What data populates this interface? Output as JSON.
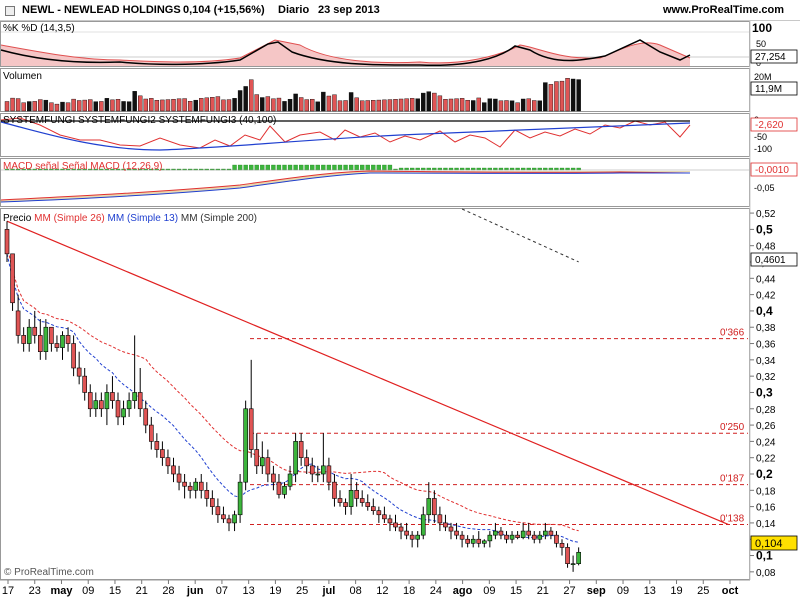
{
  "header": {
    "ticker": "NEWL - NEWLEAD HOLDINGS",
    "quote": "0,104 (+15,56%)",
    "period": "Diario",
    "date": "23 sep 2013",
    "site": "www.ProRealTime.com"
  },
  "footer": {
    "copyright": "© ProRealTime.com"
  },
  "panels": {
    "stoch": {
      "label": "%K %D (14,3,5)",
      "ticks": [
        "100",
        "50",
        "0"
      ],
      "value": "27,254"
    },
    "volume": {
      "label": "Volumen",
      "ticks": [
        "20M"
      ],
      "value": "11,9M"
    },
    "systemfungi": {
      "label": "SYSTEMFUNGI SYSTEMFUNGI2 SYSTEMFUNGI3 (40,100)",
      "ticks": [
        "0",
        "-50",
        "-100"
      ],
      "value": "-2,620"
    },
    "macd": {
      "label": "MACD señal Señal MACD (12,26,9)",
      "ticks": [
        "-0,05"
      ],
      "value": "-0,0010"
    },
    "price": {
      "label_prefix": "Precio",
      "ma26": "MM (Simple 26)",
      "ma13": "MM (Simple 13)",
      "ma200": "MM (Simple 200)",
      "value": "0,104",
      "ma_value": "0,4601"
    }
  },
  "colors": {
    "up": "#3cb53c",
    "down": "#e05555",
    "ma26": "#e03030",
    "ma13": "#2040d0",
    "ma200": "#333333",
    "trendline": "#e02020",
    "level": "#d02020"
  },
  "chart_data": {
    "type": "candlestick",
    "period": "daily",
    "x_axis_labels": [
      "17",
      "23",
      "may",
      "09",
      "15",
      "21",
      "28",
      "jun",
      "07",
      "13",
      "19",
      "25",
      "jul",
      "08",
      "12",
      "18",
      "24",
      "ago",
      "09",
      "15",
      "21",
      "27",
      "sep",
      "09",
      "13",
      "19",
      "25",
      "oct"
    ],
    "y_range": [
      0.07,
      0.525
    ],
    "y_ticks": [
      "0,52",
      "0,5",
      "0,48",
      "0,46",
      "0,44",
      "0,42",
      "0,4",
      "0,38",
      "0,36",
      "0,34",
      "0,32",
      "0,3",
      "0,28",
      "0,26",
      "0,24",
      "0,22",
      "0,2",
      "0,18",
      "0,16",
      "0,14",
      "0,12",
      "0,1",
      "0,08"
    ],
    "y_tick_values": [
      0.52,
      0.5,
      0.48,
      0.46,
      0.44,
      0.42,
      0.4,
      0.38,
      0.36,
      0.34,
      0.32,
      0.3,
      0.28,
      0.26,
      0.24,
      0.22,
      0.2,
      0.18,
      0.16,
      0.14,
      0.12,
      0.1,
      0.08
    ],
    "horizontal_levels": [
      {
        "label": "0'366",
        "value": 0.366
      },
      {
        "label": "0'250",
        "value": 0.25
      },
      {
        "label": "0'187",
        "value": 0.187
      },
      {
        "label": "0'138",
        "value": 0.138
      }
    ],
    "trendline": {
      "start": [
        0,
        0.51
      ],
      "end": [
        130,
        0.138
      ]
    },
    "last_close": 0.104,
    "ma200_last": 0.4601,
    "stochastic_last": 27.254,
    "volume_last": "11,9M",
    "systemfungi_last": -2.62,
    "macd_last": -0.001,
    "ohlc": [
      [
        0.5,
        0.51,
        0.46,
        0.47
      ],
      [
        0.47,
        0.47,
        0.4,
        0.41
      ],
      [
        0.4,
        0.42,
        0.36,
        0.37
      ],
      [
        0.37,
        0.38,
        0.35,
        0.36
      ],
      [
        0.36,
        0.39,
        0.35,
        0.38
      ],
      [
        0.38,
        0.4,
        0.36,
        0.37
      ],
      [
        0.37,
        0.39,
        0.34,
        0.35
      ],
      [
        0.35,
        0.39,
        0.34,
        0.38
      ],
      [
        0.38,
        0.38,
        0.35,
        0.36
      ],
      [
        0.36,
        0.37,
        0.35,
        0.355
      ],
      [
        0.355,
        0.375,
        0.34,
        0.37
      ],
      [
        0.37,
        0.38,
        0.35,
        0.36
      ],
      [
        0.36,
        0.37,
        0.32,
        0.33
      ],
      [
        0.33,
        0.35,
        0.31,
        0.32
      ],
      [
        0.32,
        0.33,
        0.29,
        0.3
      ],
      [
        0.3,
        0.31,
        0.27,
        0.28
      ],
      [
        0.28,
        0.3,
        0.27,
        0.29
      ],
      [
        0.29,
        0.3,
        0.27,
        0.28
      ],
      [
        0.28,
        0.31,
        0.26,
        0.3
      ],
      [
        0.3,
        0.32,
        0.28,
        0.29
      ],
      [
        0.29,
        0.3,
        0.26,
        0.27
      ],
      [
        0.27,
        0.29,
        0.26,
        0.28
      ],
      [
        0.28,
        0.3,
        0.27,
        0.29
      ],
      [
        0.29,
        0.37,
        0.28,
        0.3
      ],
      [
        0.3,
        0.33,
        0.27,
        0.28
      ],
      [
        0.28,
        0.29,
        0.25,
        0.26
      ],
      [
        0.26,
        0.27,
        0.23,
        0.24
      ],
      [
        0.24,
        0.25,
        0.22,
        0.23
      ],
      [
        0.23,
        0.24,
        0.21,
        0.22
      ],
      [
        0.22,
        0.23,
        0.2,
        0.21
      ],
      [
        0.21,
        0.22,
        0.19,
        0.2
      ],
      [
        0.2,
        0.21,
        0.18,
        0.19
      ],
      [
        0.19,
        0.2,
        0.17,
        0.185
      ],
      [
        0.185,
        0.19,
        0.17,
        0.18
      ],
      [
        0.18,
        0.195,
        0.17,
        0.19
      ],
      [
        0.19,
        0.2,
        0.17,
        0.18
      ],
      [
        0.18,
        0.19,
        0.16,
        0.17
      ],
      [
        0.17,
        0.18,
        0.15,
        0.16
      ],
      [
        0.16,
        0.17,
        0.14,
        0.15
      ],
      [
        0.15,
        0.16,
        0.14,
        0.145
      ],
      [
        0.145,
        0.15,
        0.13,
        0.14
      ],
      [
        0.14,
        0.155,
        0.13,
        0.15
      ],
      [
        0.15,
        0.2,
        0.14,
        0.19
      ],
      [
        0.19,
        0.29,
        0.18,
        0.28
      ],
      [
        0.28,
        0.34,
        0.22,
        0.23
      ],
      [
        0.23,
        0.25,
        0.2,
        0.21
      ],
      [
        0.21,
        0.24,
        0.2,
        0.22
      ],
      [
        0.22,
        0.23,
        0.19,
        0.2
      ],
      [
        0.2,
        0.21,
        0.18,
        0.19
      ],
      [
        0.19,
        0.2,
        0.17,
        0.175
      ],
      [
        0.175,
        0.19,
        0.17,
        0.185
      ],
      [
        0.185,
        0.21,
        0.18,
        0.2
      ],
      [
        0.2,
        0.25,
        0.19,
        0.24
      ],
      [
        0.24,
        0.25,
        0.21,
        0.22
      ],
      [
        0.22,
        0.23,
        0.2,
        0.21
      ],
      [
        0.21,
        0.22,
        0.19,
        0.2
      ],
      [
        0.2,
        0.21,
        0.19,
        0.2
      ],
      [
        0.2,
        0.25,
        0.19,
        0.21
      ],
      [
        0.21,
        0.22,
        0.18,
        0.19
      ],
      [
        0.19,
        0.2,
        0.16,
        0.17
      ],
      [
        0.17,
        0.18,
        0.16,
        0.165
      ],
      [
        0.165,
        0.17,
        0.15,
        0.16
      ],
      [
        0.16,
        0.2,
        0.15,
        0.18
      ],
      [
        0.18,
        0.19,
        0.16,
        0.17
      ],
      [
        0.17,
        0.18,
        0.16,
        0.165
      ],
      [
        0.165,
        0.175,
        0.155,
        0.16
      ],
      [
        0.16,
        0.17,
        0.15,
        0.155
      ],
      [
        0.155,
        0.16,
        0.14,
        0.15
      ],
      [
        0.15,
        0.16,
        0.14,
        0.145
      ],
      [
        0.145,
        0.15,
        0.13,
        0.14
      ],
      [
        0.14,
        0.15,
        0.13,
        0.135
      ],
      [
        0.135,
        0.14,
        0.12,
        0.13
      ],
      [
        0.13,
        0.14,
        0.12,
        0.125
      ],
      [
        0.125,
        0.13,
        0.11,
        0.12
      ],
      [
        0.12,
        0.13,
        0.11,
        0.125
      ],
      [
        0.125,
        0.16,
        0.12,
        0.15
      ],
      [
        0.15,
        0.19,
        0.14,
        0.17
      ],
      [
        0.17,
        0.18,
        0.14,
        0.15
      ],
      [
        0.15,
        0.16,
        0.13,
        0.14
      ],
      [
        0.14,
        0.15,
        0.13,
        0.135
      ],
      [
        0.135,
        0.14,
        0.12,
        0.13
      ],
      [
        0.13,
        0.14,
        0.12,
        0.125
      ],
      [
        0.125,
        0.13,
        0.11,
        0.12
      ],
      [
        0.12,
        0.125,
        0.11,
        0.115
      ],
      [
        0.115,
        0.125,
        0.11,
        0.12
      ],
      [
        0.12,
        0.13,
        0.11,
        0.115
      ],
      [
        0.115,
        0.12,
        0.11,
        0.118
      ],
      [
        0.118,
        0.13,
        0.11,
        0.125
      ],
      [
        0.125,
        0.14,
        0.12,
        0.13
      ],
      [
        0.13,
        0.135,
        0.12,
        0.125
      ],
      [
        0.125,
        0.13,
        0.115,
        0.12
      ],
      [
        0.12,
        0.13,
        0.115,
        0.125
      ],
      [
        0.125,
        0.13,
        0.12,
        0.122
      ],
      [
        0.122,
        0.14,
        0.12,
        0.13
      ],
      [
        0.13,
        0.14,
        0.12,
        0.125
      ],
      [
        0.125,
        0.13,
        0.115,
        0.12
      ],
      [
        0.12,
        0.13,
        0.115,
        0.125
      ],
      [
        0.125,
        0.14,
        0.12,
        0.13
      ],
      [
        0.13,
        0.135,
        0.12,
        0.125
      ],
      [
        0.125,
        0.13,
        0.11,
        0.115
      ],
      [
        0.115,
        0.12,
        0.1,
        0.11
      ],
      [
        0.11,
        0.115,
        0.085,
        0.09
      ],
      [
        0.09,
        0.1,
        0.08,
        0.09
      ],
      [
        0.09,
        0.11,
        0.088,
        0.104
      ]
    ]
  }
}
